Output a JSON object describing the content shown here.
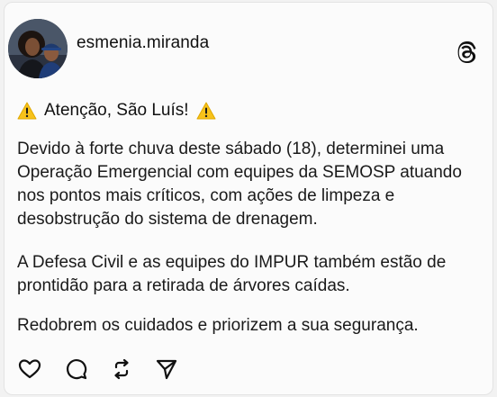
{
  "post": {
    "username": "esmenia.miranda",
    "headline": "Atenção, São Luís!",
    "paragraphs": [
      "Devido à forte chuva deste sábado (18), determinei uma Operação Emergencial com equipes da SEMOSP atuando nos pontos mais críticos, com ações de limpeza e desobstrução do sistema de drenagem.",
      "A Defesa Civil e as equipes do IMPUR também estão de prontidão para a retirada de árvores caídas.",
      "Redobrem os cuidados e priorizem a sua segurança."
    ]
  },
  "icons": {
    "avatar": "profile-photo",
    "app": "threads-icon",
    "emoji": "warning-icon",
    "actions": [
      "heart-icon",
      "comment-icon",
      "repost-icon",
      "share-icon"
    ]
  },
  "colors": {
    "text": "#1a1a1a",
    "background": "#fbfbfb",
    "warning_yellow": "#f7c21a"
  }
}
